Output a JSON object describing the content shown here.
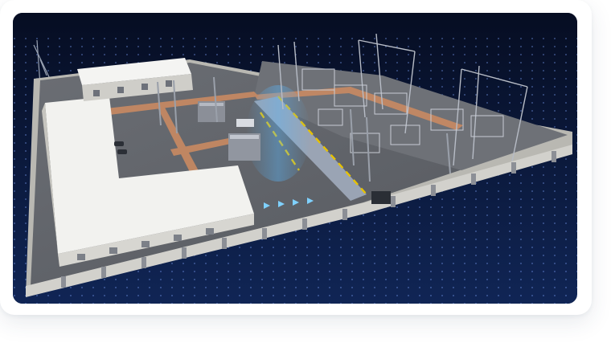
{
  "scene": {
    "subject": "substation-3d-model",
    "colors": {
      "background_top": "#060d22",
      "background_bottom": "#0f2350",
      "grid_dot": "#7fa6ff",
      "wall": "#e9e8e4",
      "floor": "#5d6066",
      "roof": "#f2f2ef",
      "road": "#c98a62",
      "highlight": "#58b8ff"
    }
  }
}
